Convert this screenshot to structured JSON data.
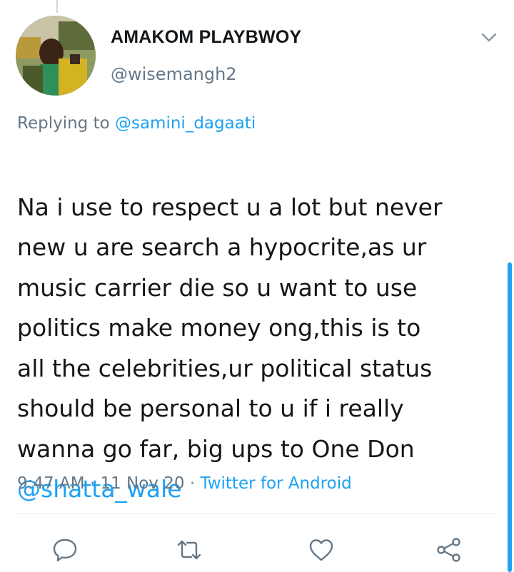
{
  "author": {
    "display_name": "AMAKOM PLAYBWOY",
    "handle": "@wisemangh2"
  },
  "reply": {
    "prefix": "Replying to ",
    "mention": "@samini_dagaati"
  },
  "tweet": {
    "text": "Na i use to respect u a lot but never\nnew u are search a hypocrite,as ur\nmusic carrier die so u want to use\npolitics make money ong,this is to\nall the celebrities,ur political status\nshould be personal to u if i really\nwanna go far, big ups to One Don",
    "mention": "@shatta_wale"
  },
  "meta": {
    "time": "9:47 AM",
    "separator1": " · ",
    "date": "11 Nov 20",
    "separator2": " · ",
    "source": "Twitter for Android"
  },
  "actions": {
    "icons": [
      "reply-icon",
      "retweet-icon",
      "like-icon",
      "share-icon"
    ]
  },
  "colors": {
    "accent": "#1da1f2",
    "secondary_text": "#657786",
    "primary_text": "#14171a",
    "divider": "#e1e8ed"
  }
}
